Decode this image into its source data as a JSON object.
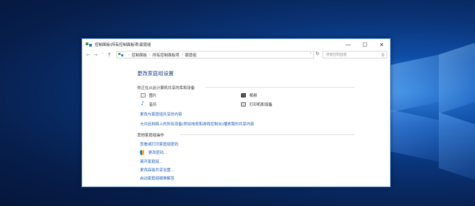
{
  "window": {
    "title": "控制面板\\所有控制面板项\\家庭组",
    "controls": {
      "minimize": "—",
      "maximize": "☐",
      "close": "✕"
    }
  },
  "addressbar": {
    "crumbs": [
      "控制面板",
      "所有控制面板项",
      "家庭组"
    ],
    "search_placeholder": "搜索控制面板"
  },
  "main": {
    "heading": "更改家庭组设置",
    "share_section": {
      "title": "你正在从此计算机共享的库和设备",
      "items": [
        {
          "label": "图片",
          "icon": "pictures-icon"
        },
        {
          "label": "视频",
          "icon": "video-icon"
        },
        {
          "label": "音乐",
          "icon": "music-icon"
        },
        {
          "label": "打印机和设备",
          "icon": "printer-icon"
        }
      ],
      "links": [
        "更改与家庭组共享的内容",
        "允许此网络上的所有设备(例如电视和游戏控制台)播放我的共享内容"
      ]
    },
    "other_section": {
      "title": "其他家庭组操作",
      "links": [
        "查看或打印家庭组密码",
        "更改密码...",
        "离开家庭组...",
        "更改高级共享设置...",
        "启动家庭组疑难解答"
      ]
    }
  }
}
